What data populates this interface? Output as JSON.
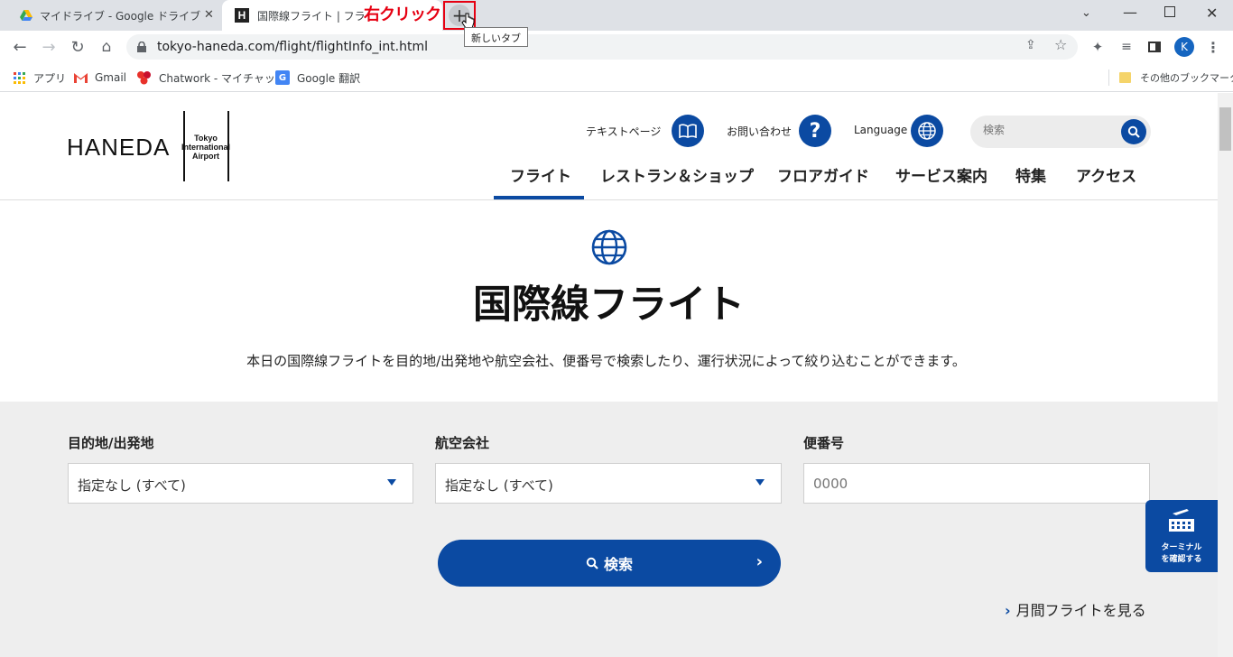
{
  "browser": {
    "tabs": [
      {
        "title": "マイドライブ - Google ドライブ",
        "icon": "google-drive-icon"
      },
      {
        "title": "国際線フライト | フライト | ",
        "icon": "haneda-h-icon",
        "favicon_letter": "H"
      }
    ],
    "annotation": "右クリック",
    "tooltip": "新しいタブ",
    "url": "tokyo-haneda.com/flight/flightInfo_int.html",
    "profile_initial": "K",
    "bookmarks": [
      {
        "label": "アプリ",
        "icon": "apps-grid-icon"
      },
      {
        "label": "Gmail",
        "icon": "gmail-icon"
      },
      {
        "label": "Chatwork - マイチャット",
        "icon": "chatwork-icon"
      },
      {
        "label": "Google 翻訳",
        "icon": "google-translate-icon"
      }
    ],
    "other_bookmarks": "その他のブックマーク"
  },
  "site": {
    "logo": {
      "word": "HANEDA",
      "line1": "Tokyo",
      "line2": "International",
      "line3": "Airport"
    },
    "utility": {
      "text_page": "テキストページ",
      "contact": "お問い合わせ",
      "language": "Language",
      "search_placeholder": "検索"
    },
    "nav": [
      "フライト",
      "レストラン＆ショップ",
      "フロアガイド",
      "サービス案内",
      "特集",
      "アクセス"
    ],
    "active_nav": "フライト",
    "page_title": "国際線フライト",
    "page_lead": "本日の国際線フライトを目的地/出発地や航空会社、便番号で検索したり、運行状況によって絞り込むことができます。",
    "form": {
      "destination_label": "目的地/出発地",
      "destination_value": "指定なし (すべて)",
      "airline_label": "航空会社",
      "airline_value": "指定なし (すべて)",
      "flight_no_label": "便番号",
      "flight_no_placeholder": "0000",
      "search_button": "検索",
      "monthly_link": "月間フライトを見る"
    },
    "terminal_button": {
      "line1": "ターミナル",
      "line2": "を確認する"
    }
  },
  "colors": {
    "brand_blue": "#0b4aa2",
    "annotation_red": "#e60012"
  }
}
